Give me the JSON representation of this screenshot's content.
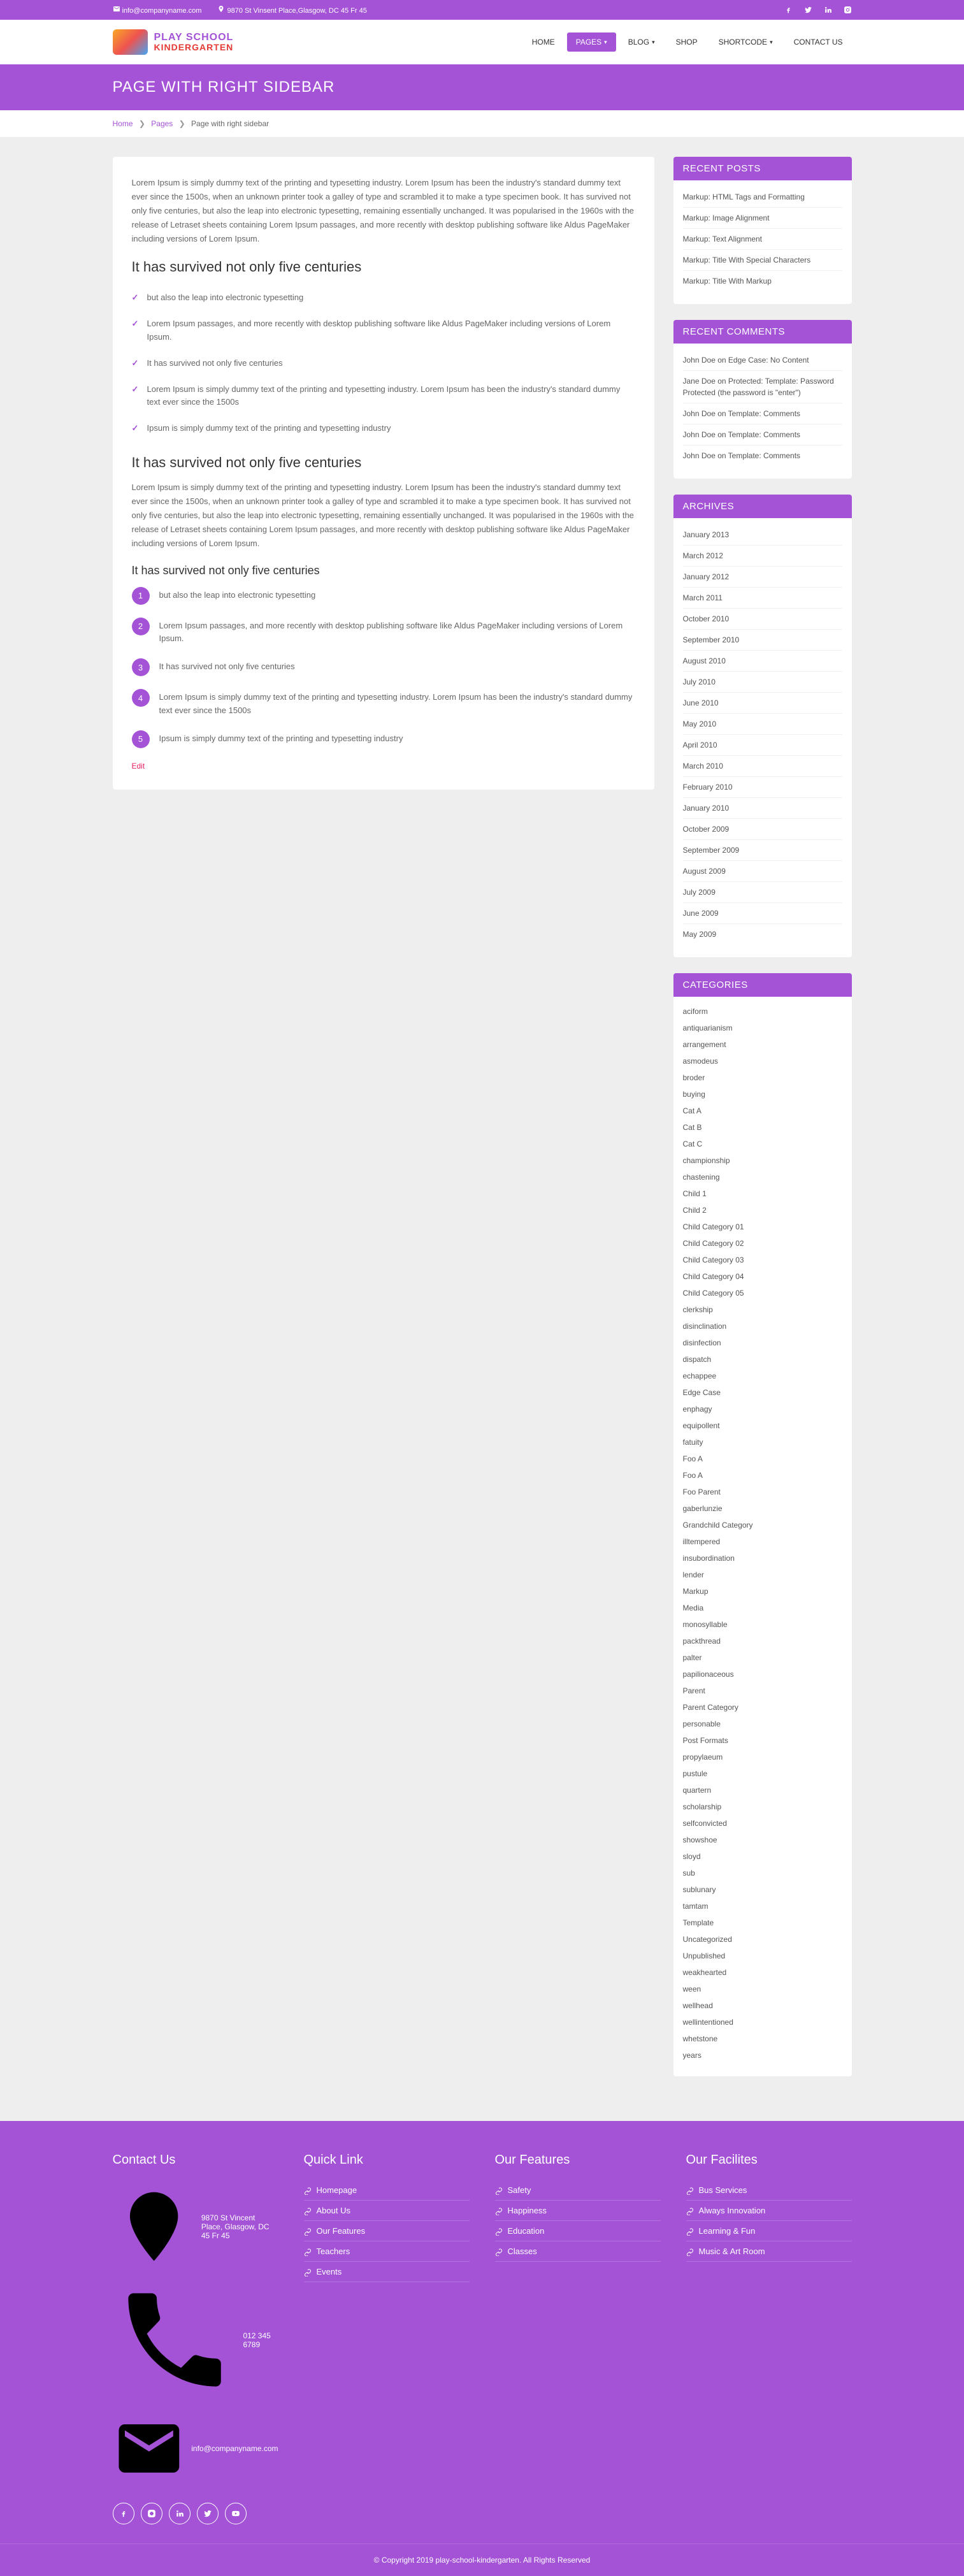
{
  "topbar": {
    "email": "info@companyname.com",
    "address": "9870 St Vinsent Place,Glasgow, DC 45 Fr 45"
  },
  "logo": {
    "line1": "PLAY SCHOOL",
    "line2": "KINDERGARTEN"
  },
  "nav": [
    {
      "label": "HOME",
      "dropdown": false,
      "active": false
    },
    {
      "label": "PAGES",
      "dropdown": true,
      "active": true
    },
    {
      "label": "BLOG",
      "dropdown": true,
      "active": false
    },
    {
      "label": "SHOP",
      "dropdown": false,
      "active": false
    },
    {
      "label": "SHORTCODE",
      "dropdown": true,
      "active": false
    },
    {
      "label": "CONTACT US",
      "dropdown": false,
      "active": false
    }
  ],
  "page_title": "PAGE WITH RIGHT SIDEBAR",
  "breadcrumb": {
    "home": "Home",
    "pages": "Pages",
    "current": "Page with right sidebar"
  },
  "content": {
    "intro": "Lorem Ipsum is simply dummy text of the printing and typesetting industry. Lorem Ipsum has been the industry's standard dummy text ever since the 1500s, when an unknown printer took a galley of type and scrambled it to make a type specimen book. It has survived not only five centuries, but also the leap into electronic typesetting, remaining essentially unchanged. It was popularised in the 1960s with the release of Letraset sheets containing Lorem Ipsum passages, and more recently with desktop publishing software like Aldus PageMaker including versions of Lorem Ipsum.",
    "h1": "It has survived not only five centuries",
    "checks": [
      "but also the leap into electronic typesetting",
      "Lorem Ipsum passages, and more recently with desktop publishing software like Aldus PageMaker including versions of Lorem Ipsum.",
      "It has survived not only five centuries",
      "Lorem Ipsum is simply dummy text of the printing and typesetting industry. Lorem Ipsum has been the industry's standard dummy text ever since the 1500s",
      "Ipsum is simply dummy text of the printing and typesetting industry"
    ],
    "h2": "It has survived not only five centuries",
    "para2": "Lorem Ipsum is simply dummy text of the printing and typesetting industry. Lorem Ipsum has been the industry's standard dummy text ever since the 1500s, when an unknown printer took a galley of type and scrambled it to make a type specimen book. It has survived not only five centuries, but also the leap into electronic typesetting, remaining essentially unchanged. It was popularised in the 1960s with the release of Letraset sheets containing Lorem Ipsum passages, and more recently with desktop publishing software like Aldus PageMaker including versions of Lorem Ipsum.",
    "h3": "It has survived not only five centuries",
    "nums": [
      "but also the leap into electronic typesetting",
      "Lorem Ipsum passages, and more recently with desktop publishing software like Aldus PageMaker including versions of Lorem Ipsum.",
      "It has survived not only five centuries",
      "Lorem Ipsum is simply dummy text of the printing and typesetting industry. Lorem Ipsum has been the industry's standard dummy text ever since the 1500s",
      "Ipsum is simply dummy text of the printing and typesetting industry"
    ],
    "edit": "Edit"
  },
  "sidebar": {
    "recent_posts": {
      "title": "RECENT POSTS",
      "items": [
        "Markup: HTML Tags and Formatting",
        "Markup: Image Alignment",
        "Markup: Text Alignment",
        "Markup: Title With Special Characters",
        "Markup: Title With Markup"
      ]
    },
    "recent_comments": {
      "title": "RECENT COMMENTS",
      "items": [
        "John Doe on Edge Case: No Content",
        "Jane Doe on Protected: Template: Password Protected (the password is \"enter\")",
        "John Doe on Template: Comments",
        "John Doe on Template: Comments",
        "John Doe on Template: Comments"
      ]
    },
    "archives": {
      "title": "ARCHIVES",
      "items": [
        "January 2013",
        "March 2012",
        "January 2012",
        "March 2011",
        "October 2010",
        "September 2010",
        "August 2010",
        "July 2010",
        "June 2010",
        "May 2010",
        "April 2010",
        "March 2010",
        "February 2010",
        "January 2010",
        "October 2009",
        "September 2009",
        "August 2009",
        "July 2009",
        "June 2009",
        "May 2009"
      ]
    },
    "categories": {
      "title": "CATEGORIES",
      "items": [
        "aciform",
        "antiquarianism",
        "arrangement",
        "asmodeus",
        "broder",
        "buying",
        "Cat A",
        "Cat B",
        "Cat C",
        "championship",
        "chastening",
        "Child 1",
        "Child 2",
        "Child Category 01",
        "Child Category 02",
        "Child Category 03",
        "Child Category 04",
        "Child Category 05",
        "clerkship",
        "disinclination",
        "disinfection",
        "dispatch",
        "echappee",
        "Edge Case",
        "enphagy",
        "equipollent",
        "fatuity",
        "Foo A",
        "Foo A",
        "Foo Parent",
        "gaberlunzie",
        "Grandchild Category",
        "illtempered",
        "insubordination",
        "lender",
        "Markup",
        "Media",
        "monosyllable",
        "packthread",
        "palter",
        "papilionaceous",
        "Parent",
        "Parent Category",
        "personable",
        "Post Formats",
        "propylaeum",
        "pustule",
        "quartern",
        "scholarship",
        "selfconvicted",
        "showshoe",
        "sloyd",
        "sub",
        "sublunary",
        "tamtam",
        "Template",
        "Uncategorized",
        "Unpublished",
        "weakhearted",
        "ween",
        "wellhead",
        "wellintentioned",
        "whetstone",
        "years"
      ]
    }
  },
  "footer": {
    "contact": {
      "title": "Contact Us",
      "address": "9870 St Vincent Place, Glasgow, DC 45 Fr 45",
      "phone": "012 345 6789",
      "email": "info@companyname.com"
    },
    "quick": {
      "title": "Quick Link",
      "items": [
        "Homepage",
        "About Us",
        "Our Features",
        "Teachers",
        "Events"
      ]
    },
    "features": {
      "title": "Our Features",
      "items": [
        "Safety",
        "Happiness",
        "Education",
        "Classes"
      ]
    },
    "facilities": {
      "title": "Our Facilites",
      "items": [
        "Bus Services",
        "Always Innovation",
        "Learning & Fun",
        "Music & Art Room"
      ]
    }
  },
  "copyright": "© Copyright 2019 play-school-kindergarten. All Rights Reserved"
}
